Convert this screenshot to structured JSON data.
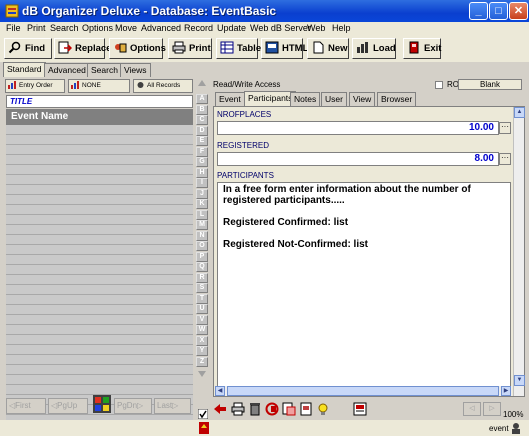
{
  "window": {
    "title": "dB Organizer Deluxe - Database: EventBasic",
    "minimize": "_",
    "maximize": "□",
    "close": "✕"
  },
  "menu": [
    "File",
    "Print",
    "Search",
    "Options",
    "Move",
    "Advanced",
    "Record",
    "Update",
    "Web dB Server",
    "Web",
    "Help"
  ],
  "toolbar": {
    "find": "Find",
    "replace": "Replace",
    "options": "Options",
    "print": "Print",
    "table": "Table",
    "html": "HTML",
    "new": "New",
    "load": "Load",
    "exit": "Exit"
  },
  "left_tabs": [
    "Standard",
    "Advanced",
    "Search",
    "Views"
  ],
  "sort": {
    "entry_order": "Entry Order",
    "none": "NONE",
    "all_records": "All Records"
  },
  "list": {
    "header": "TITLE",
    "selected": "Event Name"
  },
  "left_nav": {
    "first": "First",
    "pgup": "PgUp",
    "pgdn": "PgDn",
    "last": "Last"
  },
  "letters": [
    "A",
    "B",
    "C",
    "D",
    "E",
    "F",
    "G",
    "H",
    "I",
    "J",
    "K",
    "L",
    "M",
    "N",
    "O",
    "P",
    "Q",
    "R",
    "S",
    "T",
    "U",
    "V",
    "W",
    "X",
    "Y",
    "Z"
  ],
  "record": {
    "access": "Read/Write Access",
    "ro_label": "RO",
    "blank_button": "Blank"
  },
  "record_tabs": [
    "Event",
    "Participants",
    "Notes",
    "User",
    "View",
    "Browser"
  ],
  "fields": {
    "nrofplaces_label": "NROFPLACES",
    "nrofplaces_value": "10.00",
    "registered_label": "REGISTERED",
    "registered_value": "8.00",
    "participants_label": "PARTICIPANTS",
    "ellipsis": "···",
    "participants_lines": [
      "In a free form enter information about the number of registered participants.....",
      "Registered Confirmed: list",
      "Registered Not-Confirmed: list"
    ]
  },
  "status": {
    "zoom": "100%",
    "mode": "event"
  },
  "colors": {
    "titlebar": "#0a46d8",
    "selected_row": "#808080",
    "field_value": "#0000cc",
    "label": "#00006a"
  }
}
